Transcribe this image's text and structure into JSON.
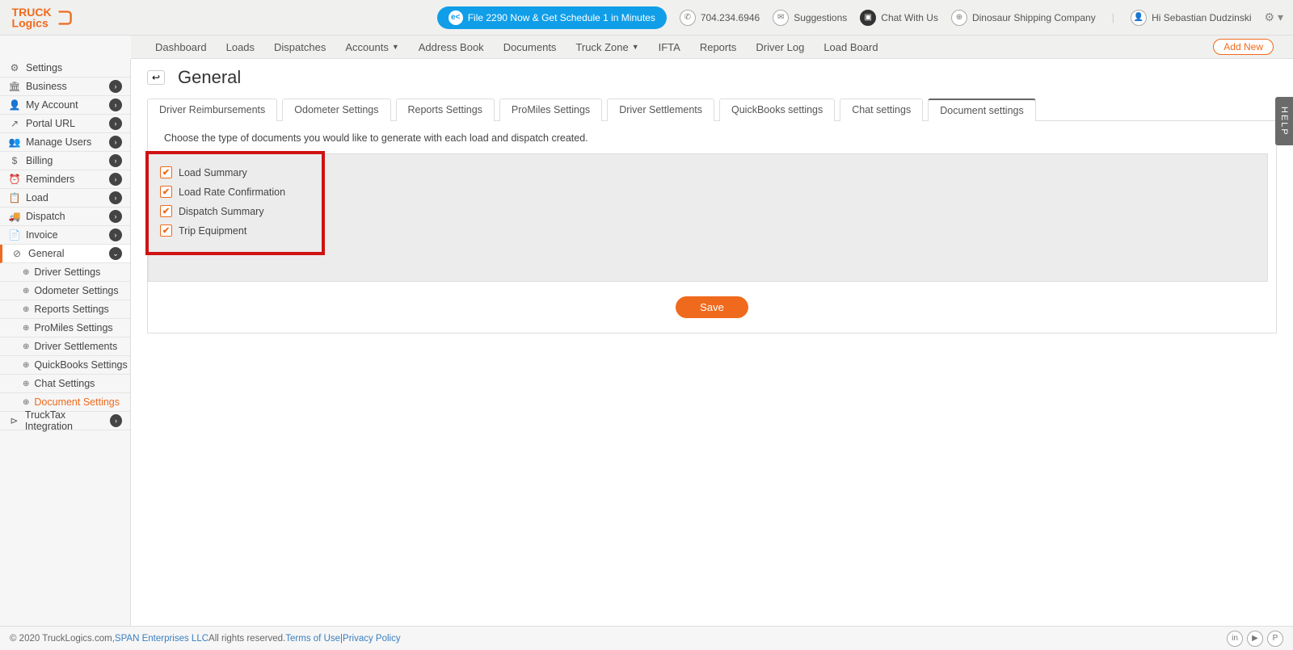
{
  "top": {
    "pill": "File 2290 Now & Get Schedule 1 in Minutes",
    "pill_badge": "e<",
    "phone": "704.234.6946",
    "suggestions": "Suggestions",
    "chat": "Chat With Us",
    "company": "Dinosaur Shipping Company",
    "greeting": "Hi Sebastian Dudzinski"
  },
  "nav": {
    "items": [
      "Dashboard",
      "Loads",
      "Dispatches",
      "Accounts",
      "Address Book",
      "Documents",
      "Truck Zone",
      "IFTA",
      "Reports",
      "Driver Log",
      "Load Board"
    ],
    "add_new": "Add New"
  },
  "sidebar": {
    "items": [
      {
        "icon": "⚙",
        "label": "Settings"
      },
      {
        "icon": "🏛",
        "label": "Business"
      },
      {
        "icon": "👤",
        "label": "My Account"
      },
      {
        "icon": "↗",
        "label": "Portal URL"
      },
      {
        "icon": "👥",
        "label": "Manage Users"
      },
      {
        "icon": "$",
        "label": "Billing"
      },
      {
        "icon": "⏰",
        "label": "Reminders"
      },
      {
        "icon": "📋",
        "label": "Load"
      },
      {
        "icon": "🚚",
        "label": "Dispatch"
      },
      {
        "icon": "📄",
        "label": "Invoice"
      },
      {
        "icon": "⊘",
        "label": "General"
      },
      {
        "icon": "⊳",
        "label": "TruckTax Integration"
      }
    ],
    "subs": [
      "Driver Settings",
      "Odometer Settings",
      "Reports Settings",
      "ProMiles Settings",
      "Driver Settlements",
      "QuickBooks Settings",
      "Chat Settings",
      "Document Settings"
    ]
  },
  "page": {
    "title": "General",
    "tabs": [
      "Driver Reimbursements",
      "Odometer Settings",
      "Reports Settings",
      "ProMiles Settings",
      "Driver Settlements",
      "QuickBooks settings",
      "Chat settings",
      "Document settings"
    ],
    "hint": "Choose the type of documents you would like to generate with each load and dispatch created.",
    "checks": [
      "Load Summary",
      "Load Rate Confirmation",
      "Dispatch Summary",
      "Trip Equipment"
    ],
    "save": "Save"
  },
  "footer": {
    "copyright": "© 2020 TruckLogics.com, ",
    "span": "SPAN Enterprises LLC",
    "rights": " All rights reserved. ",
    "terms": "Terms of Use",
    "sep": " | ",
    "privacy": "Privacy Policy"
  },
  "help": "HELP"
}
